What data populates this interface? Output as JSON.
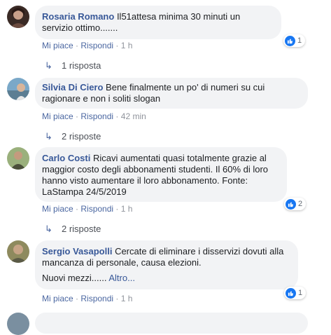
{
  "comments": [
    {
      "author": "Rosaria Romano",
      "text": "Il51attesa minima 30 minuti un servizio ottimo.......",
      "actions": {
        "like": "Mi piace",
        "reply": "Rispondi",
        "time": "1 h"
      },
      "reaction_count": "1",
      "replies": "1 risposta"
    },
    {
      "author": "Silvia Di Ciero",
      "text": "Bene finalmente un po' di numeri su cui ragionare e non i soliti slogan",
      "actions": {
        "like": "Mi piace",
        "reply": "Rispondi",
        "time": "42 min"
      },
      "replies": "2 risposte"
    },
    {
      "author": "Carlo Costi",
      "text": "Ricavi aumentati quasi totalmente grazie al maggior costo degli abbonamenti studenti. Il 60% di loro hanno visto aumentare il loro abbonamento. Fonte: LaStampa 24/5/2019",
      "actions": {
        "like": "Mi piace",
        "reply": "Rispondi",
        "time": "1 h"
      },
      "reaction_count": "2",
      "replies": "2 risposte"
    },
    {
      "author": "Sergio Vasapolli",
      "text": "Cercate di eliminare i disservizi dovuti alla mancanza di personale, causa elezioni.",
      "text2": "Nuovi mezzi......",
      "more": "Altro...",
      "actions": {
        "like": "Mi piace",
        "reply": "Rispondi",
        "time": "1 h"
      },
      "reaction_count": "1"
    }
  ],
  "separator": "·",
  "colors": {
    "author": "#385898",
    "bubble": "#f2f3f5",
    "like": "#1877f2",
    "meta": "#4b67a1"
  },
  "icons": {
    "reply_arrow": "reply-arrow-icon",
    "like": "thumbs-up-icon"
  }
}
